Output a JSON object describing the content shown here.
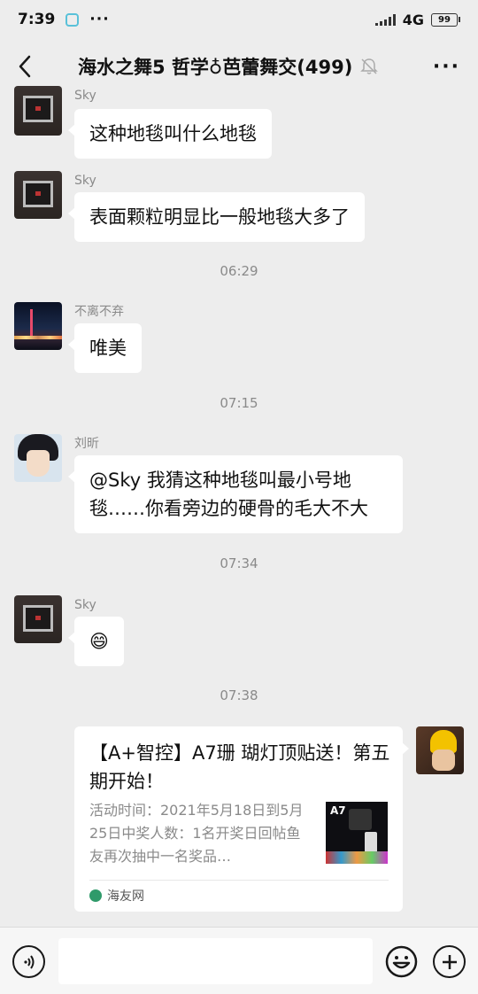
{
  "status_bar": {
    "time": "7:39",
    "dots": "···",
    "network": "4G",
    "battery": "99"
  },
  "header": {
    "title": "海水之舞5 哲学♁芭蕾舞交(499)",
    "more": "···"
  },
  "messages": [
    {
      "sender": "Sky",
      "text": "这种地毯叫什么地毯"
    },
    {
      "sender": "Sky",
      "text": "表面颗粒明显比一般地毯大多了"
    },
    {
      "sender": "不离不弃",
      "text": "唯美"
    },
    {
      "sender": "刘昕",
      "text": "@Sky  我猜这种地毯叫最小号地毯……你看旁边的硬骨的毛大不大"
    },
    {
      "sender": "Sky",
      "text": "😄"
    }
  ],
  "timestamps": [
    "06:29",
    "07:15",
    "07:34",
    "07:38"
  ],
  "link_card": {
    "title": "【A+智控】A7珊 瑚灯顶贴送！第五期开始！",
    "description": "活动时间：2021年5月18日到5月25日中奖人数：1名开奖日回帖鱼友再次抽中一名奖品…",
    "thumb_label": "A7",
    "source": "海友网"
  },
  "colors": {
    "background": "#ededed",
    "bubble": "#ffffff",
    "meta_text": "#8a8a8a",
    "source_icon": "#2f9a6a"
  },
  "icons": [
    "back-icon",
    "mute-icon",
    "more-icon",
    "voice-icon",
    "emoji-icon",
    "plus-icon"
  ]
}
